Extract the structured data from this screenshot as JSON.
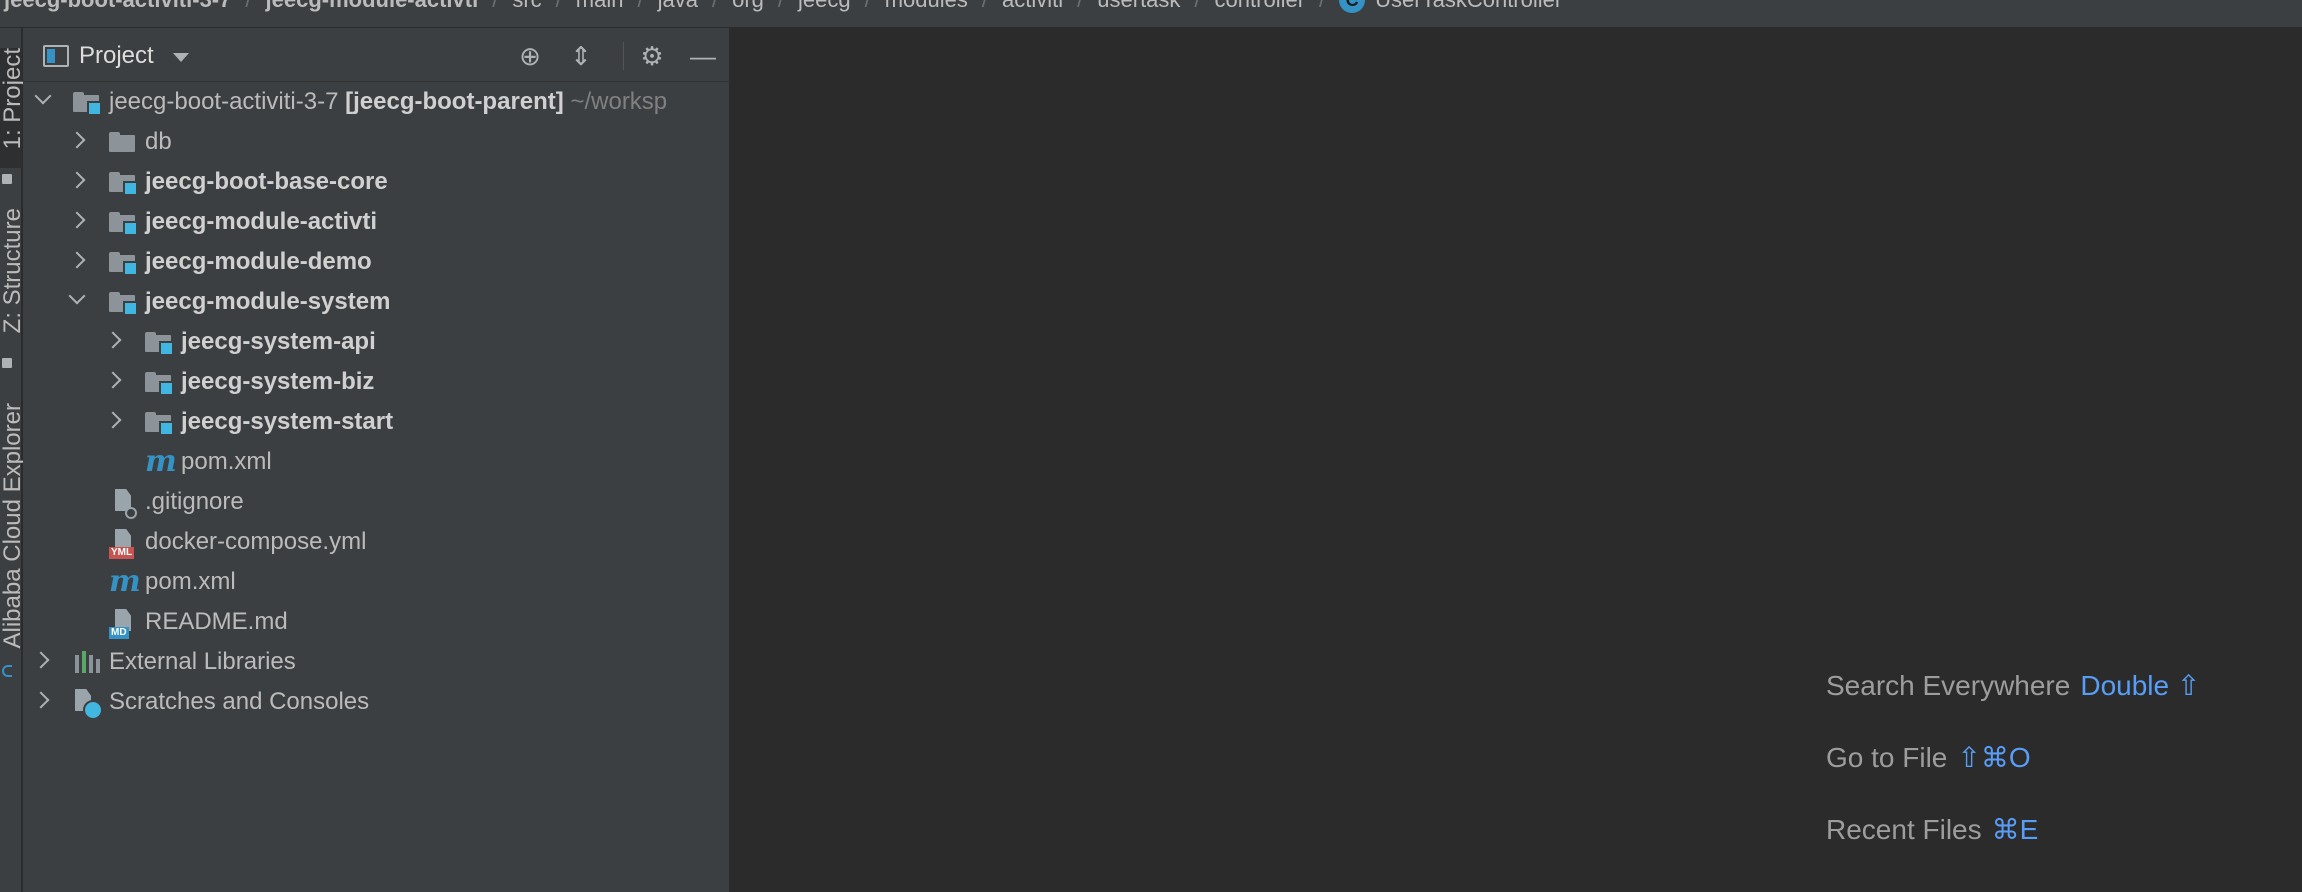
{
  "breadcrumb": {
    "items": [
      {
        "label": "jeecg-boot-activiti-3-7",
        "bold": true
      },
      {
        "label": "jeecg-module-activti",
        "bold": true
      },
      {
        "label": "src"
      },
      {
        "label": "main"
      },
      {
        "label": "java"
      },
      {
        "label": "org"
      },
      {
        "label": "jeecg"
      },
      {
        "label": "modules"
      },
      {
        "label": "activiti"
      },
      {
        "label": "usertask"
      },
      {
        "label": "controller"
      },
      {
        "label": "UserTaskController",
        "icon": "class-icon"
      }
    ],
    "separator": "/"
  },
  "tool_strip": {
    "project_tab": "1: Project",
    "structure_tab": "Z: Structure",
    "cloud_tab": "Alibaba Cloud Explorer"
  },
  "panel": {
    "title": "Project",
    "buttons": [
      "locate-icon",
      "collapse-all-icon",
      "gear-icon",
      "hide-icon"
    ]
  },
  "tree": {
    "root": {
      "label": "jeecg-boot-activiti-3-7",
      "suffix_bold": "[jeecg-boot-parent]",
      "suffix_path": "~/worksp"
    },
    "items": [
      {
        "label": "db",
        "bold": false
      },
      {
        "label": "jeecg-boot-base-core",
        "bold": true
      },
      {
        "label": "jeecg-module-activti",
        "bold": true
      },
      {
        "label": "jeecg-module-demo",
        "bold": true
      },
      {
        "label": "jeecg-module-system",
        "bold": true
      },
      {
        "label": "jeecg-system-api",
        "bold": true
      },
      {
        "label": "jeecg-system-biz",
        "bold": true
      },
      {
        "label": "jeecg-system-start",
        "bold": true
      },
      {
        "label": "pom.xml",
        "bold": false
      },
      {
        "label": ".gitignore",
        "bold": false
      },
      {
        "label": "docker-compose.yml",
        "bold": false
      },
      {
        "label": "pom.xml",
        "bold": false
      },
      {
        "label": "README.md",
        "bold": false
      },
      {
        "label": "External Libraries",
        "bold": false
      },
      {
        "label": "Scratches and Consoles",
        "bold": false
      }
    ]
  },
  "editor_hints": [
    {
      "label": "Search Everywhere",
      "key": "Double ⇧"
    },
    {
      "label": "Go to File",
      "key": "⇧⌘O"
    },
    {
      "label": "Recent Files",
      "key": "⌘E"
    }
  ],
  "icon_badges": {
    "yml": "YML",
    "md": "MD",
    "maven": "m"
  }
}
